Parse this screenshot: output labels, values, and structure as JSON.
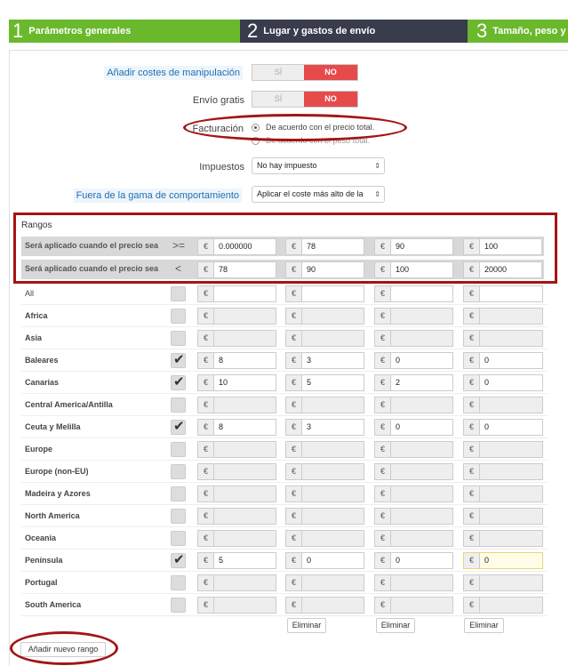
{
  "steps": [
    {
      "num": "1",
      "label": "Parámetros generales"
    },
    {
      "num": "2",
      "label": "Lugar y gastos de envío"
    },
    {
      "num": "3",
      "label": "Tamaño, peso y gr"
    }
  ],
  "form": {
    "handling_label": "Añadir costes de manipulación",
    "free_label": "Envío gratis",
    "switch_yes": "SÍ",
    "switch_no": "NO",
    "billing_label": "Facturación",
    "billing_opt1": "De acuerdo con el precio total.",
    "billing_opt2": "De acuerdo con el peso total.",
    "tax_label": "Impuestos",
    "tax_value": "No hay impuesto",
    "out_of_range_label": "Fuera de la gama de comportamiento",
    "out_of_range_value": "Aplicar el coste más alto de la"
  },
  "ranges": {
    "title": "Rangos",
    "row_label": "Será aplicado cuando el precio sea",
    "ge_op": ">=",
    "lt_op": "<",
    "currency": "€",
    "from": [
      "0.000000",
      "78",
      "90",
      "100"
    ],
    "to": [
      "78",
      "90",
      "100",
      "20000"
    ]
  },
  "zones": [
    {
      "name": "All",
      "checked": false,
      "values": [
        "",
        "",
        "",
        ""
      ]
    },
    {
      "name": "Africa",
      "checked": false,
      "values": [
        "",
        "",
        "",
        ""
      ]
    },
    {
      "name": "Asia",
      "checked": false,
      "values": [
        "",
        "",
        "",
        ""
      ]
    },
    {
      "name": "Baleares",
      "checked": true,
      "values": [
        "8",
        "3",
        "0",
        "0"
      ]
    },
    {
      "name": "Canarias",
      "checked": true,
      "values": [
        "10",
        "5",
        "2",
        "0"
      ]
    },
    {
      "name": "Central America/Antilla",
      "checked": false,
      "values": [
        "",
        "",
        "",
        ""
      ]
    },
    {
      "name": "Ceuta y Melilla",
      "checked": true,
      "values": [
        "8",
        "3",
        "0",
        "0"
      ]
    },
    {
      "name": "Europe",
      "checked": false,
      "values": [
        "",
        "",
        "",
        ""
      ]
    },
    {
      "name": "Europe (non-EU)",
      "checked": false,
      "values": [
        "",
        "",
        "",
        ""
      ]
    },
    {
      "name": "Madeira y Azores",
      "checked": false,
      "values": [
        "",
        "",
        "",
        ""
      ]
    },
    {
      "name": "North America",
      "checked": false,
      "values": [
        "",
        "",
        "",
        ""
      ]
    },
    {
      "name": "Oceania",
      "checked": false,
      "values": [
        "",
        "",
        "",
        ""
      ]
    },
    {
      "name": "Península",
      "checked": true,
      "values": [
        "5",
        "0",
        "0",
        "0"
      ]
    },
    {
      "name": "Portugal",
      "checked": false,
      "values": [
        "",
        "",
        "",
        ""
      ]
    },
    {
      "name": "South America",
      "checked": false,
      "values": [
        "",
        "",
        "",
        ""
      ]
    }
  ],
  "buttons": {
    "delete": "Eliminar",
    "add_range": "Añadir nuevo rango"
  },
  "colors": {
    "step_green": "#6ab92d",
    "step_dark": "#383c4c",
    "no_red": "#e64b4b",
    "annotation_red": "#a31515"
  }
}
